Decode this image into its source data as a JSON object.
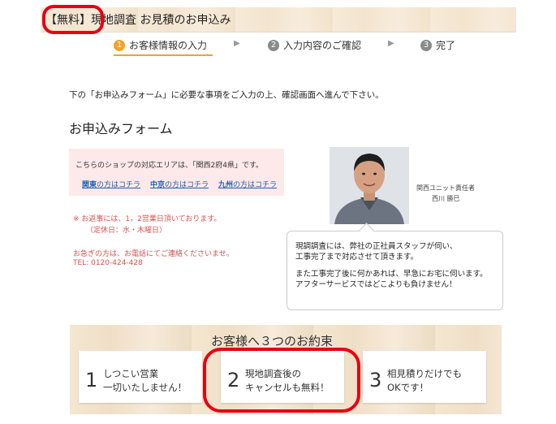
{
  "header": {
    "title": "【無料】現地調査 お見積のお申込み"
  },
  "steps": [
    {
      "num": "1",
      "label": "お客様情報の入力"
    },
    {
      "num": "2",
      "label": "入力内容のご確認"
    },
    {
      "num": "3",
      "label": "完了"
    }
  ],
  "arrow_symbol": "▶",
  "intro_text": "下の「お申込みフォーム」に必要な事項をご入力の上、確認画面へ進んで下さい。",
  "form_heading": "お申込みフォーム",
  "area_box": {
    "text": "こちらのショップの対応エリアは、「関西2府4県」です。",
    "links": [
      {
        "bold": "関東",
        "rest": "の方はコチラ"
      },
      {
        "bold": "中京",
        "rest": "の方はコチラ"
      },
      {
        "bold": "九州",
        "rest": "の方はコチラ"
      }
    ]
  },
  "notes": {
    "reply_line1": "※ お返事には、1，2営業日頂いております。",
    "reply_line2": "（定休日：水・木曜日）",
    "phone_line1": "お急ぎの方は、お電話にてご連絡くださいませ。",
    "phone_line2": "TEL: 0120-424-428"
  },
  "staff": {
    "role": "関西ユニット責任者",
    "name": "西川 勝巳"
  },
  "bubble": {
    "line1": "現調調査には、弊社の正社員スタッフが伺い、",
    "line2": "工事完了まで対応させて頂きます。",
    "line3": "また工事完了後に何かあれば、早急にお宅に伺います。",
    "line4": "アフターサービスではどこよりも負けません！"
  },
  "promise": {
    "title": "お客様へ３つのお約束",
    "cards": [
      {
        "num": "1",
        "line1": "しつこい営業",
        "line2": "一切いたしません！"
      },
      {
        "num": "2",
        "line1": "現地調査後の",
        "line2": "キャンセルも無料！"
      },
      {
        "num": "3",
        "line1": "相見積りだけでも",
        "line2": "OKです！"
      }
    ]
  },
  "colors": {
    "accent": "#f0a22c",
    "highlight": "#e60012",
    "link": "#1e5fb3",
    "note": "#d9534f"
  }
}
